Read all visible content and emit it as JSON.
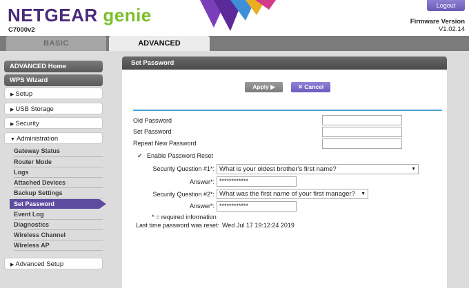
{
  "header": {
    "brand": "NETGEAR",
    "product": " genie",
    "model": "C7000v2",
    "logout_label": "Logout",
    "firmware_label": "Firmware Version",
    "firmware_value": "V1.02.14"
  },
  "tabs": [
    {
      "label": "BASIC"
    },
    {
      "label": "ADVANCED"
    }
  ],
  "sidebar": {
    "advanced_home": "ADVANCED Home",
    "wps_wizard": "WPS Wizard",
    "setup": "Setup",
    "usb_storage": "USB Storage",
    "security": "Security",
    "administration": "Administration",
    "admin_items": [
      "Gateway Status",
      "Router Mode",
      "Logs",
      "Attached Devices",
      "Backup Settings",
      "Set Password",
      "Event Log",
      "Diagnostics",
      "Wireless Channel",
      "Wireless AP"
    ],
    "advanced_setup": "Advanced Setup"
  },
  "panel": {
    "title": "Set Password",
    "apply_label": "Apply ▶",
    "cancel_label": "✕ Cancel",
    "old_password_label": "Old Password",
    "set_password_label": "Set Password",
    "repeat_password_label": "Repeat New Password",
    "enable_reset_label": "Enable Password Reset",
    "q1_label": "Security Question #1*:",
    "q1_value": "What is your oldest brother's first name?",
    "answer1_label": "Answer*:",
    "answer1_value": "************",
    "q2_label": "Security Question #2*:",
    "q2_value": "What was the first name of your first manager?",
    "answer2_label": "Answer*:",
    "answer2_value": "************",
    "required_note": "* = required information",
    "last_reset_label": "Last time password was reset:",
    "last_reset_value": "Wed Jul 17 19:12:24 2019"
  },
  "colors": {
    "brand_purple": "#4a2a7c",
    "genie_green": "#7bbf2a",
    "active_nav": "#5c4b9e",
    "divider_blue": "#4aa3d4"
  }
}
